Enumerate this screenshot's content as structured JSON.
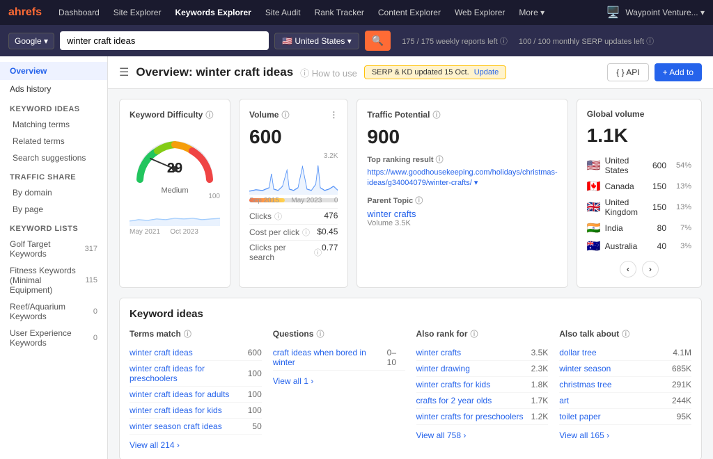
{
  "nav": {
    "logo": "ahrefs",
    "items": [
      {
        "label": "Dashboard",
        "active": false
      },
      {
        "label": "Site Explorer",
        "active": false
      },
      {
        "label": "Keywords Explorer",
        "active": true
      },
      {
        "label": "Site Audit",
        "active": false
      },
      {
        "label": "Rank Tracker",
        "active": false
      },
      {
        "label": "Content Explorer",
        "active": false
      },
      {
        "label": "Web Explorer",
        "active": false
      },
      {
        "label": "More ▾",
        "active": false
      }
    ],
    "account": "Waypoint Venture... ▾"
  },
  "search": {
    "engine": "Google ▾",
    "query": "winter craft ideas",
    "country": "🇺🇸 United States ▾",
    "stats1": "175 / 175 weekly reports left ⓘ",
    "stats2": "100 / 100 monthly SERP updates left ⓘ"
  },
  "sidebar": {
    "overview_label": "Overview",
    "ads_history_label": "Ads history",
    "keyword_ideas_section": "Keyword ideas",
    "matching_terms": "Matching terms",
    "related_terms": "Related terms",
    "search_suggestions": "Search suggestions",
    "traffic_share_section": "Traffic share",
    "by_domain": "By domain",
    "by_page": "By page",
    "keyword_lists_section": "Keyword lists",
    "lists": [
      {
        "name": "Golf Target Keywords",
        "count": "317"
      },
      {
        "name": "Fitness Keywords (Minimal Equipment)",
        "count": "115"
      },
      {
        "name": "Reef/Aquarium Keywords",
        "count": "0"
      },
      {
        "name": "User Experience Keywords",
        "count": "0"
      }
    ]
  },
  "page_header": {
    "title": "Overview: winter craft ideas",
    "help_label": "ⓘ How to use",
    "update_badge": "SERP & KD updated 15 Oct.",
    "update_link": "Update",
    "api_btn": "{ } API",
    "add_btn": "+ Add to"
  },
  "difficulty_card": {
    "title": "Keyword Difficulty",
    "help": "ⓘ",
    "value": 29,
    "label": "Medium",
    "chart_start": "May 2021",
    "chart_end": "Oct 2023",
    "chart_max": "100"
  },
  "volume_card": {
    "title": "Volume",
    "help": "ⓘ",
    "value": "600",
    "chart_start": "Sep 2015",
    "chart_end": "May 2023",
    "chart_max": "3.2K",
    "chart_min": "0",
    "clicks_label": "Clicks",
    "clicks_help": "ⓘ",
    "clicks_value": "476",
    "cpc_label": "Cost per click",
    "cpc_help": "ⓘ",
    "cpc_value": "$0.45",
    "cps_label": "Clicks per search",
    "cps_help": "ⓘ",
    "cps_value": "0.77"
  },
  "traffic_card": {
    "title": "Traffic Potential",
    "help": "ⓘ",
    "value": "900",
    "top_ranking_label": "Top ranking result",
    "top_ranking_help": "ⓘ",
    "top_ranking_url": "https://www.goodhousekeeping.com/holidays/christmas-ideas/g34004079/winter-crafts/",
    "top_ranking_url_short": "https://www.goodhouseekeepi ng.com/holidays/christmas-idea s/g34004079/winter-crafts/ ▾",
    "parent_topic_label": "Parent Topic",
    "parent_topic_help": "ⓘ",
    "parent_topic": "winter crafts",
    "parent_volume": "Volume 3.5K"
  },
  "global_volume_card": {
    "title": "Global volume",
    "value": "1.1K",
    "countries": [
      {
        "flag": "us",
        "name": "United States",
        "vol": "600",
        "pct": "54%"
      },
      {
        "flag": "ca",
        "name": "Canada",
        "vol": "150",
        "pct": "13%"
      },
      {
        "flag": "uk",
        "name": "United Kingdom",
        "vol": "150",
        "pct": "13%"
      },
      {
        "flag": "in",
        "name": "India",
        "vol": "80",
        "pct": "7%"
      },
      {
        "flag": "au",
        "name": "Australia",
        "vol": "40",
        "pct": "3%"
      }
    ],
    "prev_btn": "‹",
    "next_btn": "›"
  },
  "keyword_ideas": {
    "section_title": "Keyword ideas",
    "terms_match": {
      "title": "Terms match",
      "help": "ⓘ",
      "items": [
        {
          "label": "winter craft ideas",
          "vol": "600"
        },
        {
          "label": "winter craft ideas for preschoolers",
          "vol": "100"
        },
        {
          "label": "winter craft ideas for adults",
          "vol": "100"
        },
        {
          "label": "winter craft ideas for kids",
          "vol": "100"
        },
        {
          "label": "winter season craft ideas",
          "vol": "50"
        }
      ],
      "view_all": "View all 214 ›"
    },
    "questions": {
      "title": "Questions",
      "help": "ⓘ",
      "items": [
        {
          "label": "craft ideas when bored in winter",
          "vol": "0–10"
        }
      ],
      "view_all": "View all 1 ›"
    },
    "also_rank_for": {
      "title": "Also rank for",
      "help": "ⓘ",
      "items": [
        {
          "label": "winter crafts",
          "vol": "3.5K"
        },
        {
          "label": "winter drawing",
          "vol": "2.3K"
        },
        {
          "label": "winter crafts for kids",
          "vol": "1.8K"
        },
        {
          "label": "crafts for 2 year olds",
          "vol": "1.7K"
        },
        {
          "label": "winter crafts for preschoolers",
          "vol": "1.2K"
        }
      ],
      "view_all": "View all 758 ›"
    },
    "also_talk_about": {
      "title": "Also talk about",
      "help": "ⓘ",
      "items": [
        {
          "label": "dollar tree",
          "vol": "4.1M"
        },
        {
          "label": "winter season",
          "vol": "685K"
        },
        {
          "label": "christmas tree",
          "vol": "291K"
        },
        {
          "label": "art",
          "vol": "244K"
        },
        {
          "label": "toilet paper",
          "vol": "95K"
        }
      ],
      "view_all": "View all 165 ›"
    }
  }
}
